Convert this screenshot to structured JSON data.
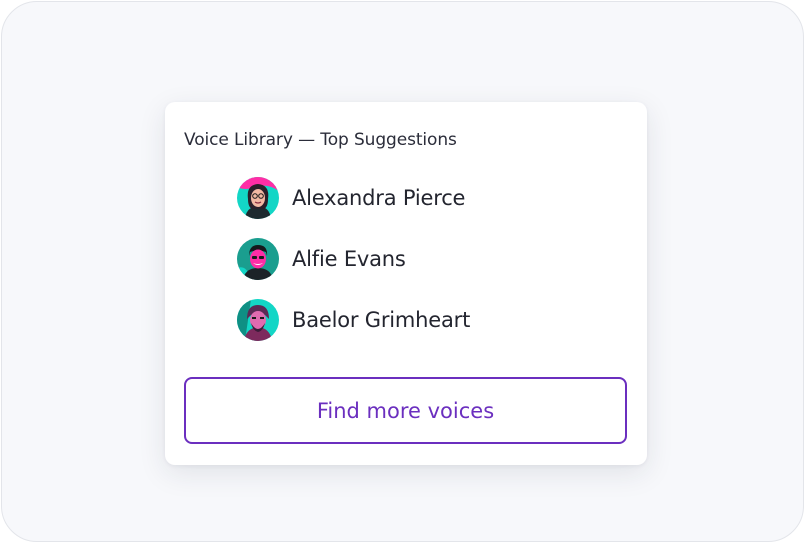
{
  "library": {
    "title": "Voice Library — Top Suggestions",
    "voices": [
      {
        "name": "Alexandra Pierce",
        "avatar": "woman-portrait-avatar"
      },
      {
        "name": "Alfie Evans",
        "avatar": "man-portrait-avatar"
      },
      {
        "name": "Baelor Grimheart",
        "avatar": "warrior-portrait-avatar"
      }
    ],
    "find_more_label": "Find more voices"
  },
  "colors": {
    "accent": "#6b2fbf",
    "avatar_teal": "#13d6c6",
    "avatar_pink": "#ff2da6",
    "text": "#23252f",
    "page_background": "#f7f8fb"
  }
}
